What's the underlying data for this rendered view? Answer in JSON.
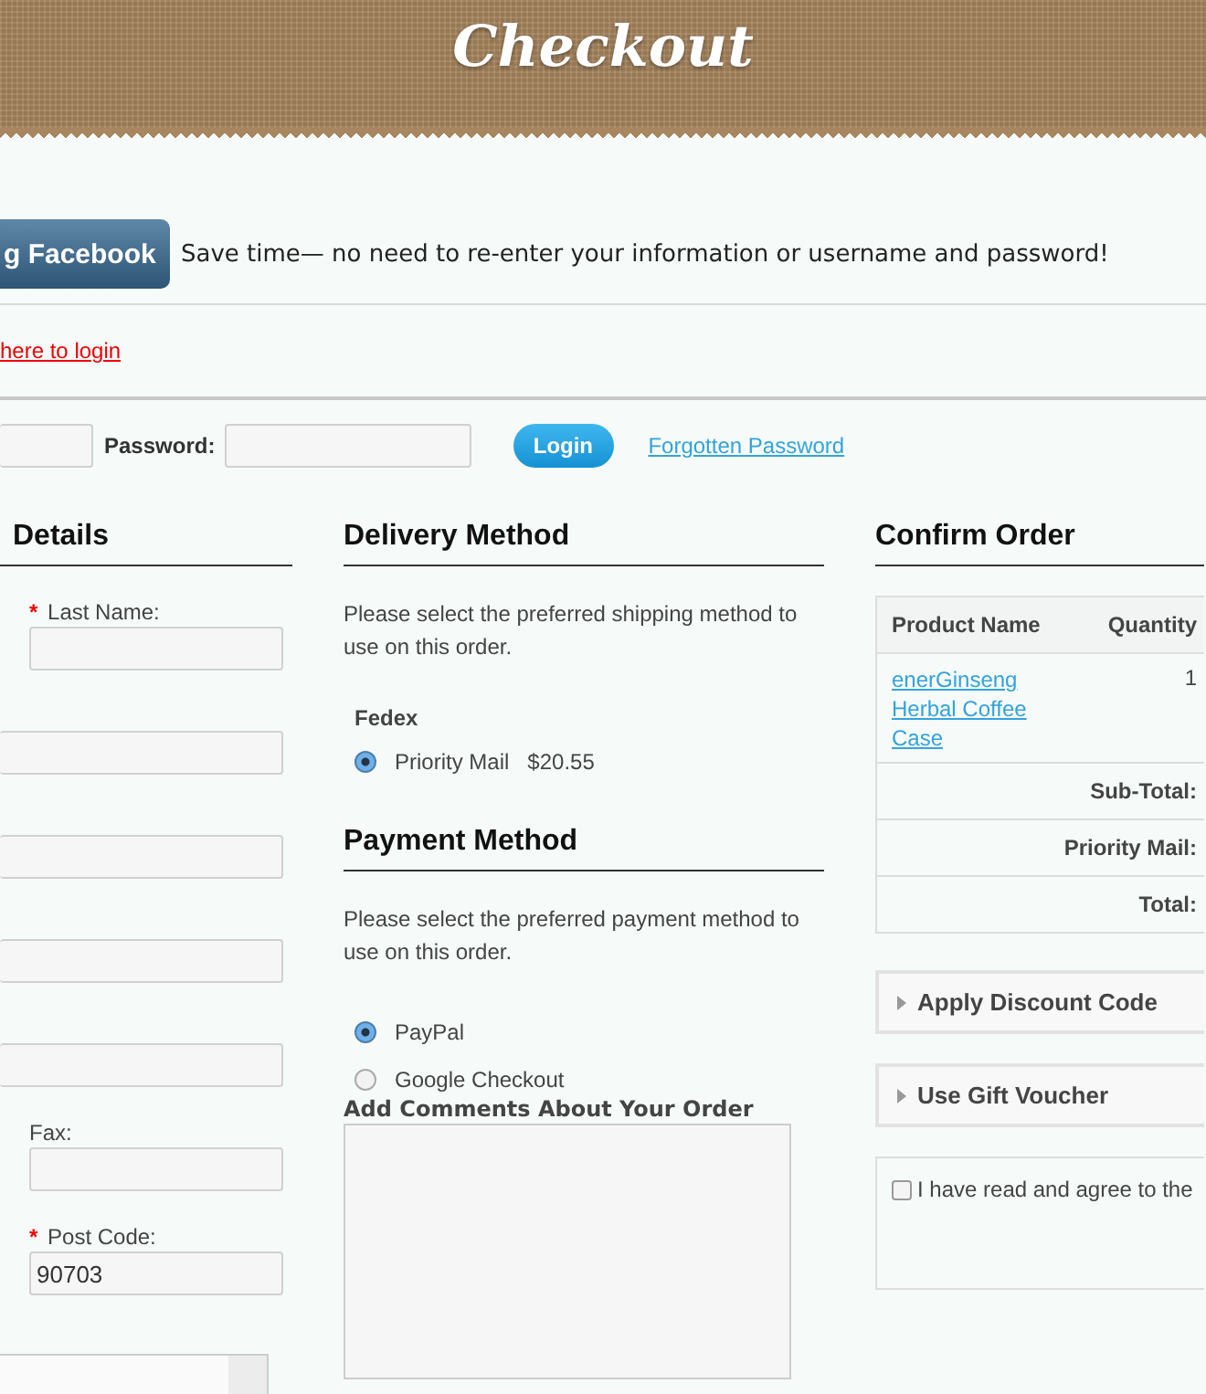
{
  "header": {
    "title": "Checkout"
  },
  "facebook": {
    "button": "g Facebook",
    "note": "Save time— no need to re-enter your information or username and password!"
  },
  "login_link": "here to login",
  "login": {
    "password_label": "Password:",
    "button": "Login",
    "forgot_link": "Forgotten Password"
  },
  "details": {
    "title": "Details",
    "fields": [
      {
        "kind": "input",
        "label": "Last Name:",
        "required_mark": "*"
      },
      {
        "kind": "input"
      },
      {
        "kind": "input"
      },
      {
        "kind": "input"
      },
      {
        "kind": "input"
      },
      {
        "kind": "input",
        "label": "Fax:"
      },
      {
        "kind": "input",
        "label": "Post Code:",
        "required_mark": "*",
        "value": "90703"
      },
      {
        "kind": "select"
      }
    ]
  },
  "delivery": {
    "title": "Delivery Method",
    "note": "Please select the preferred shipping method to use on this order.",
    "carrier": "Fedex",
    "options": [
      {
        "label": "Priority Mail",
        "price": "$20.55",
        "selected": true
      }
    ]
  },
  "payment": {
    "title": "Payment Method",
    "note": "Please select the preferred payment method to use on this order.",
    "options": [
      {
        "label": "PayPal",
        "selected": true
      },
      {
        "label": "Google Checkout",
        "selected": false
      }
    ],
    "comments_label": "Add Comments About Your Order"
  },
  "confirm": {
    "title": "Confirm Order",
    "columns": [
      "Product Name",
      "Quantity"
    ],
    "items": [
      {
        "name": "enerGinseng Herbal Coffee Case",
        "quantity": "1"
      }
    ],
    "totals": [
      "Sub-Total:",
      "Priority Mail:",
      "Total:"
    ],
    "panels": [
      "Apply Discount Code",
      "Use Gift Voucher"
    ],
    "agree": {
      "label": "I have read and agree to the",
      "checked": false
    }
  }
}
